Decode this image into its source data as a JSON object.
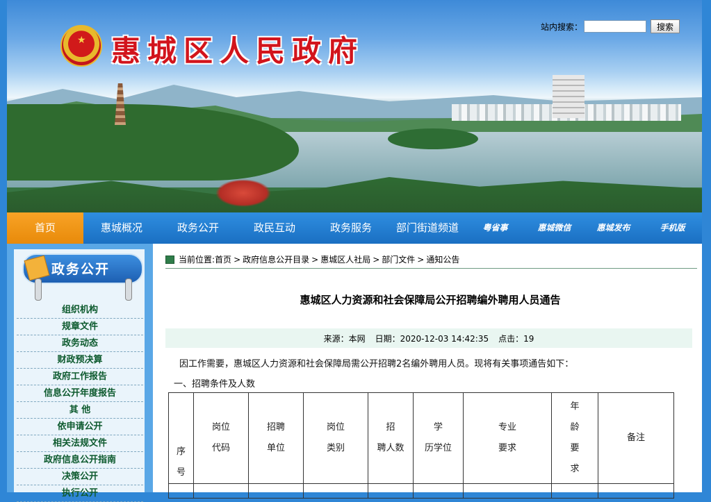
{
  "header": {
    "site_title": "惠城区人民政府",
    "emblem_icon": "national-emblem",
    "search_label": "站内搜索：",
    "search_value": "",
    "search_button": "搜索"
  },
  "nav": {
    "items": [
      {
        "label": "首页",
        "active": true
      },
      {
        "label": "惠城概况"
      },
      {
        "label": "政务公开"
      },
      {
        "label": "政民互动"
      },
      {
        "label": "政务服务"
      },
      {
        "label": "部门街道频道"
      },
      {
        "label": "粤省事"
      },
      {
        "label": "惠城微信"
      },
      {
        "label": "惠城发布"
      },
      {
        "label": "手机版"
      }
    ]
  },
  "sidebar": {
    "heading": "政务公开",
    "items": [
      {
        "label": "组织机构"
      },
      {
        "label": "规章文件"
      },
      {
        "label": "政务动态"
      },
      {
        "label": "财政预决算"
      },
      {
        "label": "政府工作报告"
      },
      {
        "label": "信息公开年度报告"
      },
      {
        "label": "其 他"
      },
      {
        "label": "依申请公开"
      },
      {
        "label": "相关法规文件"
      },
      {
        "label": "政府信息公开指南"
      },
      {
        "label": "决策公开"
      },
      {
        "label": "执行公开"
      }
    ]
  },
  "breadcrumb": {
    "prefix": "当前位置:",
    "items": [
      "首页",
      "政府信息公开目录",
      "惠城区人社局",
      "部门文件",
      "通知公告"
    ],
    "separator": ">"
  },
  "article": {
    "title": "惠城区人力资源和社会保障局公开招聘编外聘用人员通告",
    "meta": {
      "source": "来源：本网",
      "date": "日期：2020-12-03 14:42:35",
      "clicks": "点击：19"
    },
    "intro": "因工作需要，惠城区人力资源和社会保障局需公开招聘2名编外聘用人员。现将有关事项通告如下：",
    "section1": "一、招聘条件及人数"
  },
  "table": {
    "headers": [
      [
        "序",
        "号"
      ],
      [
        "岗位",
        "代码"
      ],
      [
        "招聘",
        "单位"
      ],
      [
        "岗位",
        "类别"
      ],
      [
        "招",
        "聘人数"
      ],
      [
        "学",
        "历学位"
      ],
      [
        "专业",
        "要求"
      ],
      [
        "年",
        "龄",
        "要",
        "求"
      ],
      [
        "备注"
      ]
    ]
  }
}
